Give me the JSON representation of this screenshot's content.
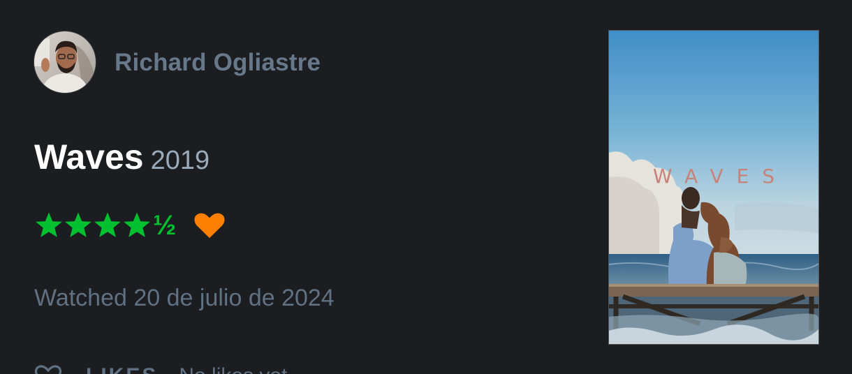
{
  "user": {
    "name": "Richard Ogliastre"
  },
  "film": {
    "title": "Waves",
    "year": "2019",
    "poster_title": "WAVES"
  },
  "rating": {
    "stars": 4.5,
    "half_glyph": "½",
    "liked": true
  },
  "watched_text": "Watched 20 de julio de 2024",
  "footer": {
    "likes_label": "LIKES",
    "no_likes_text": "No likes yet"
  },
  "colors": {
    "background": "#1b1d21",
    "star_green": "#00c030",
    "heart_orange": "#ff8000",
    "muted_text": "#5f7183"
  }
}
